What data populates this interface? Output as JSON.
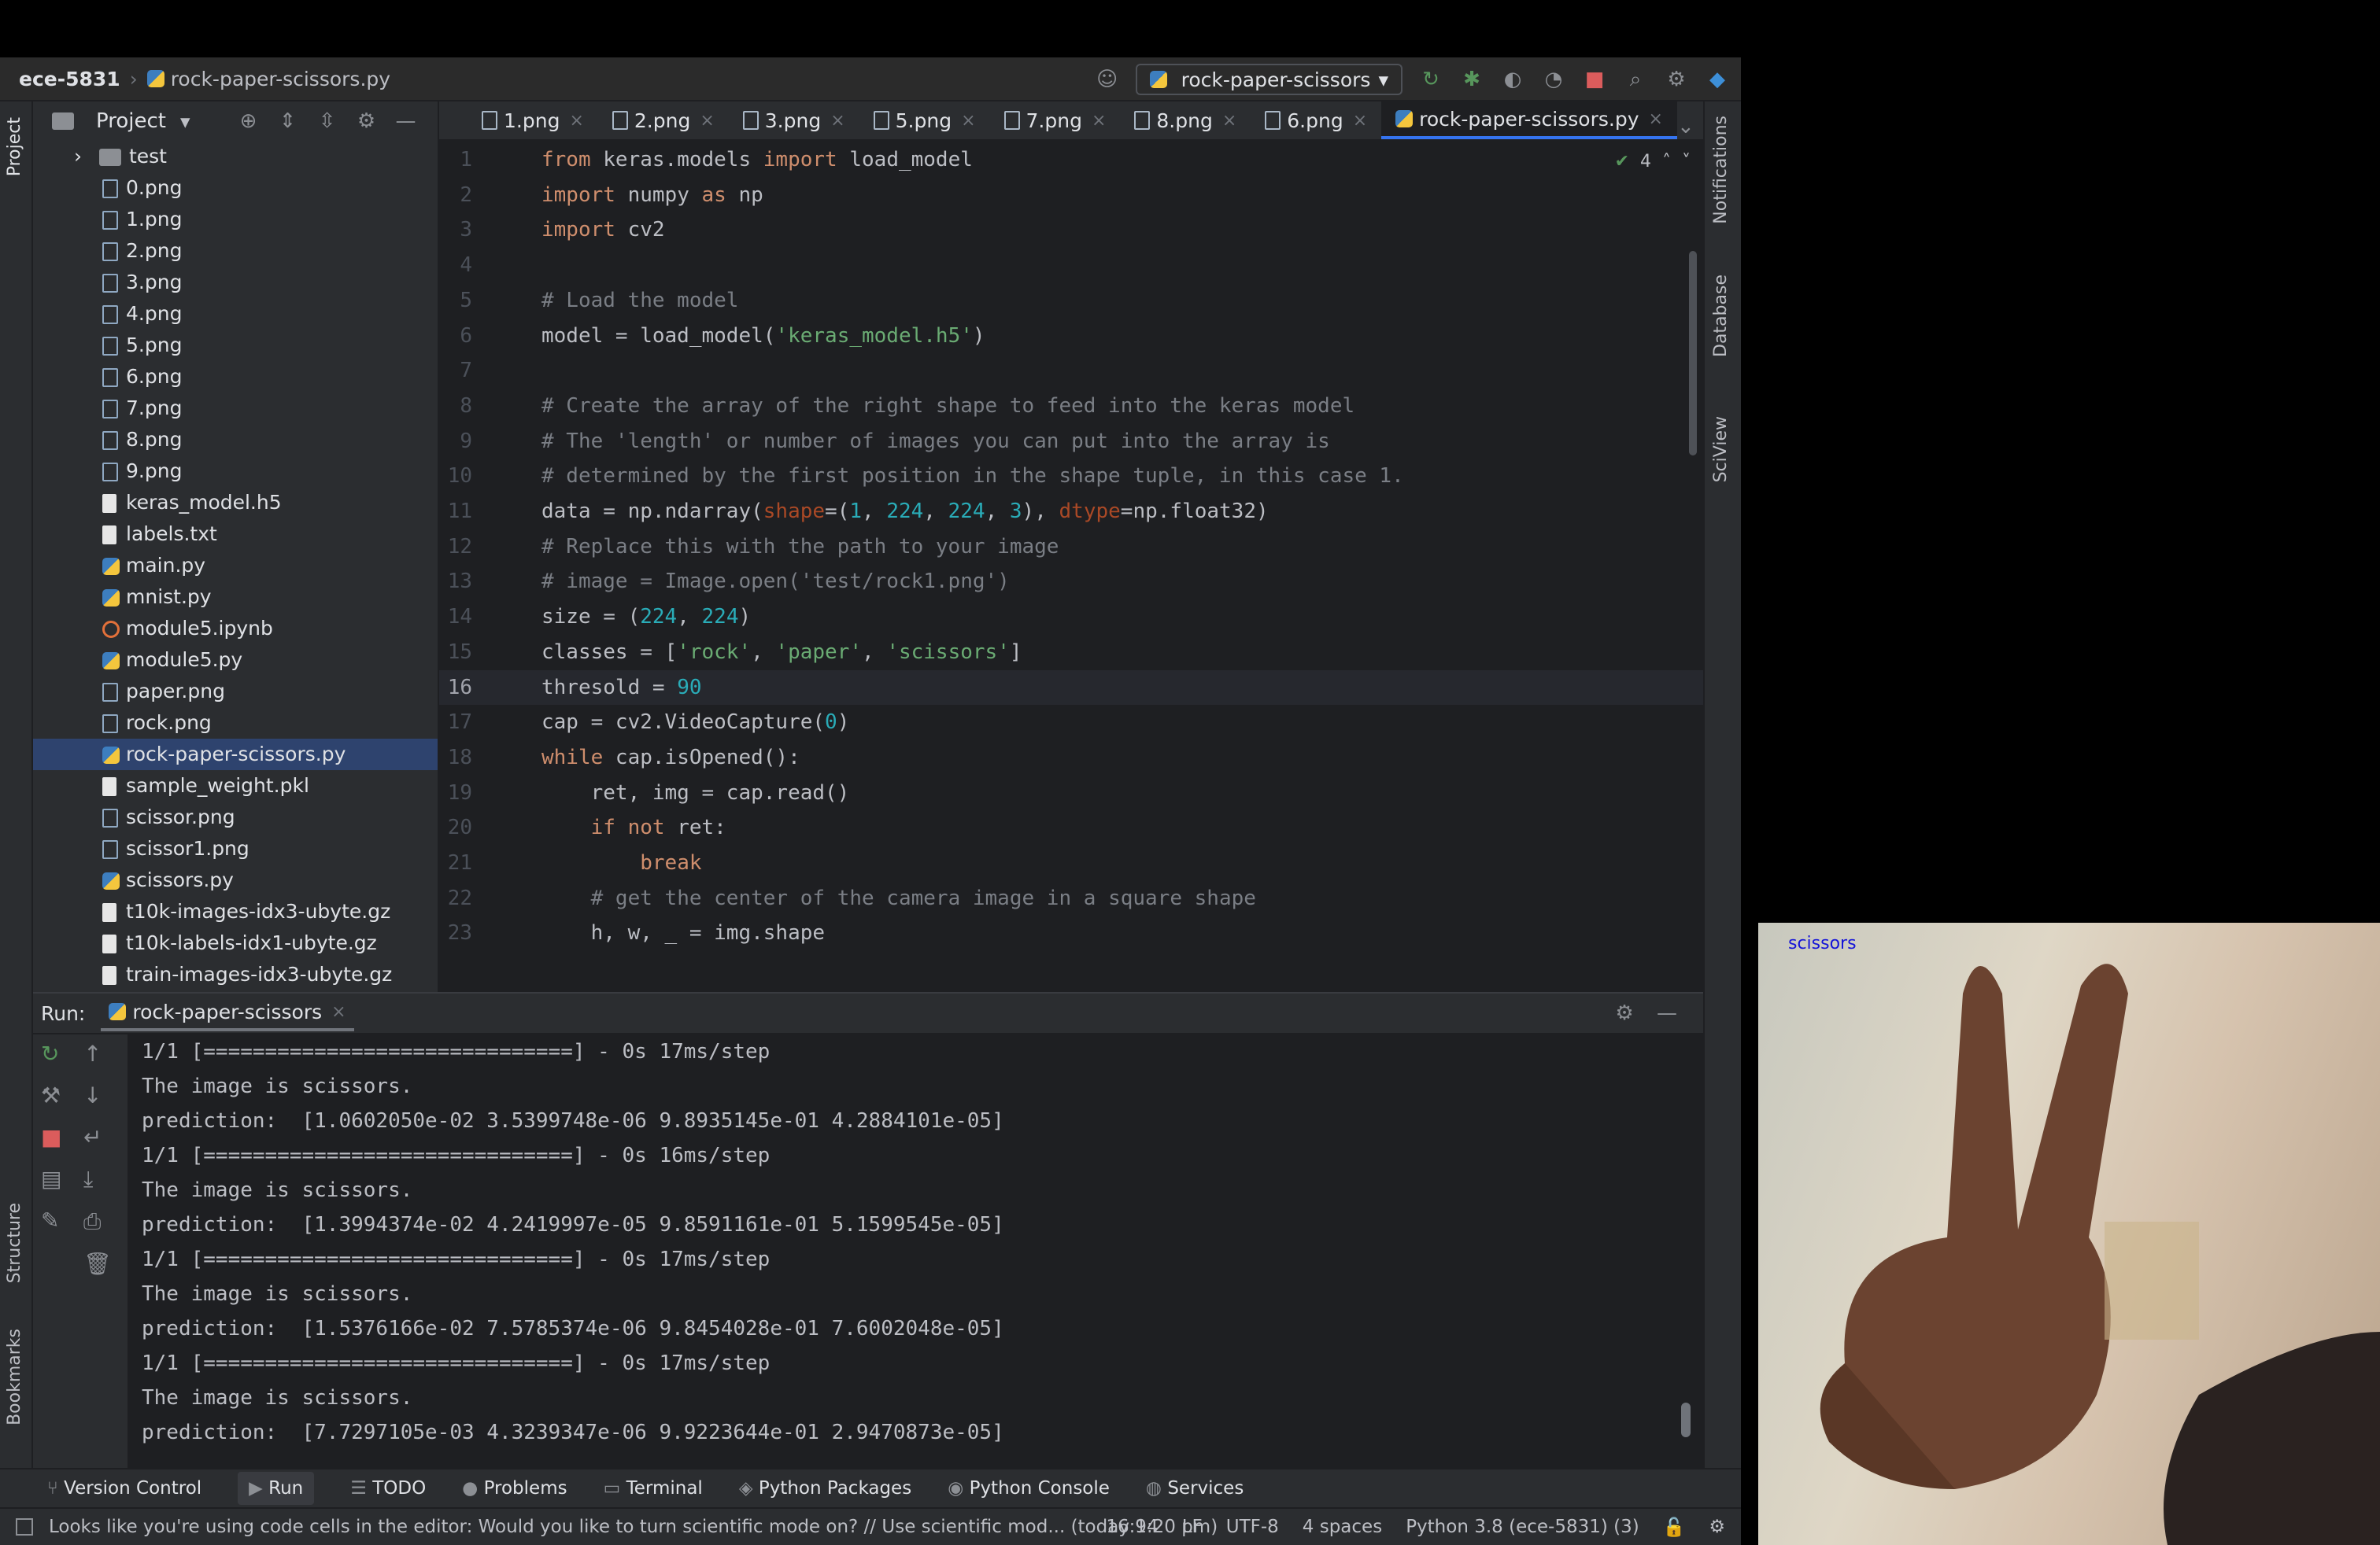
{
  "navbar": {
    "project": "ece-5831",
    "file": "rock-paper-scissors.py",
    "run_config": "rock-paper-scissors"
  },
  "project_panel": {
    "title": "Project",
    "items": [
      {
        "label": "test",
        "kind": "folder"
      },
      {
        "label": "0.png",
        "kind": "img"
      },
      {
        "label": "1.png",
        "kind": "img"
      },
      {
        "label": "2.png",
        "kind": "img"
      },
      {
        "label": "3.png",
        "kind": "img"
      },
      {
        "label": "4.png",
        "kind": "img"
      },
      {
        "label": "5.png",
        "kind": "img"
      },
      {
        "label": "6.png",
        "kind": "img"
      },
      {
        "label": "7.png",
        "kind": "img"
      },
      {
        "label": "8.png",
        "kind": "img"
      },
      {
        "label": "9.png",
        "kind": "img"
      },
      {
        "label": "keras_model.h5",
        "kind": "file"
      },
      {
        "label": "labels.txt",
        "kind": "file"
      },
      {
        "label": "main.py",
        "kind": "py"
      },
      {
        "label": "mnist.py",
        "kind": "py"
      },
      {
        "label": "module5.ipynb",
        "kind": "nb"
      },
      {
        "label": "module5.py",
        "kind": "py"
      },
      {
        "label": "paper.png",
        "kind": "img"
      },
      {
        "label": "rock.png",
        "kind": "img"
      },
      {
        "label": "rock-paper-scissors.py",
        "kind": "py",
        "selected": true
      },
      {
        "label": "sample_weight.pkl",
        "kind": "file"
      },
      {
        "label": "scissor.png",
        "kind": "img"
      },
      {
        "label": "scissor1.png",
        "kind": "img"
      },
      {
        "label": "scissors.py",
        "kind": "py"
      },
      {
        "label": "t10k-images-idx3-ubyte.gz",
        "kind": "file"
      },
      {
        "label": "t10k-labels-idx1-ubyte.gz",
        "kind": "file"
      },
      {
        "label": "train-images-idx3-ubyte.gz",
        "kind": "file"
      }
    ]
  },
  "tabs": [
    "1.png",
    "2.png",
    "3.png",
    "5.png",
    "7.png",
    "8.png",
    "6.png",
    "rock-paper-scissors.py"
  ],
  "editor": {
    "inspections": "4",
    "current_line": "16"
  },
  "code": [
    "from keras.models import load_model",
    "import numpy as np",
    "import cv2",
    "",
    "# Load the model",
    "model = load_model('keras_model.h5')",
    "",
    "# Create the array of the right shape to feed into the keras model",
    "# The 'length' or number of images you can put into the array is",
    "# determined by the first position in the shape tuple, in this case 1.",
    "data = np.ndarray(shape=(1, 224, 224, 3), dtype=np.float32)",
    "# Replace this with the path to your image",
    "# image = Image.open('test/rock1.png')",
    "size = (224, 224)",
    "classes = ['rock', 'paper', 'scissors']",
    "thresold = 90",
    "cap = cv2.VideoCapture(0)",
    "while cap.isOpened():",
    "    ret, img = cap.read()",
    "    if not ret:",
    "        break",
    "    # get the center of the camera image in a square shape",
    "    h, w, _ = img.shape"
  ],
  "run": {
    "label": "Run:",
    "tab": "rock-paper-scissors"
  },
  "console": [
    "1/1 [==============================] - 0s 17ms/step",
    "The image is scissors.",
    "prediction:  [1.0602050e-02 3.5399748e-06 9.8935145e-01 4.2884101e-05]",
    "1/1 [==============================] - 0s 16ms/step",
    "The image is scissors.",
    "prediction:  [1.3994374e-02 4.2419997e-05 9.8591161e-01 5.1599545e-05]",
    "1/1 [==============================] - 0s 17ms/step",
    "The image is scissors.",
    "prediction:  [1.5376166e-02 7.5785374e-06 9.8454028e-01 7.6002048e-05]",
    "1/1 [==============================] - 0s 17ms/step",
    "The image is scissors.",
    "prediction:  [7.7297105e-03 4.3239347e-06 9.9223644e-01 2.9470873e-05]"
  ],
  "side_labels": {
    "left": [
      "Project",
      "Structure",
      "Bookmarks"
    ],
    "right": [
      "Notifications",
      "Database",
      "SciView"
    ]
  },
  "bottom_tabs": [
    "Version Control",
    "Run",
    "TODO",
    "Problems",
    "Terminal",
    "Python Packages",
    "Python Console",
    "Services"
  ],
  "status": {
    "message": "Looks like you're using code cells in the editor: Would you like to turn scientific mode on? // Use scientific mod... (today 9:20 pm)",
    "position": "16:14",
    "line_sep": "LF",
    "encoding": "UTF-8",
    "indent": "4 spaces",
    "interpreter": "Python 3.8 (ece-5831) (3)"
  },
  "camera": {
    "label": "scissors"
  },
  "colors": {
    "accent": "#3574f0",
    "selection": "#2e436e",
    "bg": "#1e1f22"
  }
}
